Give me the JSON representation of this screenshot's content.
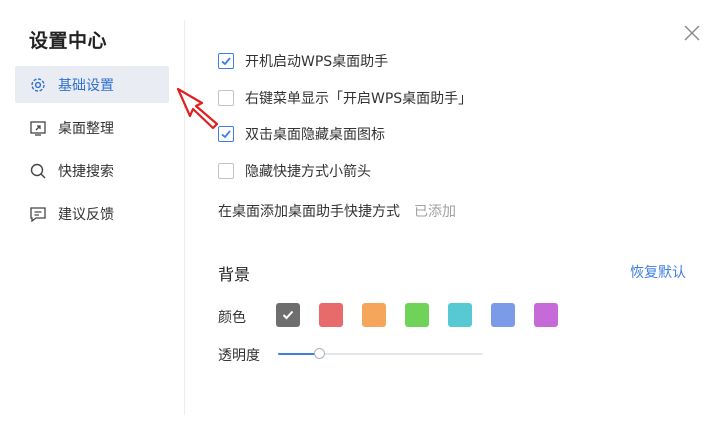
{
  "dialog": {
    "title": "设置中心"
  },
  "sidebar": {
    "items": [
      {
        "label": "基础设置",
        "icon": "gear-icon",
        "active": true
      },
      {
        "label": "桌面整理",
        "icon": "desktop-arrange-icon",
        "active": false
      },
      {
        "label": "快捷搜索",
        "icon": "search-icon",
        "active": false
      },
      {
        "label": "建议反馈",
        "icon": "feedback-icon",
        "active": false
      }
    ]
  },
  "options": [
    {
      "label": "开机启动WPS桌面助手",
      "checked": true
    },
    {
      "label": "右键菜单显示「开启WPS桌面助手」",
      "checked": false
    },
    {
      "label": "双击桌面隐藏桌面图标",
      "checked": true
    },
    {
      "label": "隐藏快捷方式小箭头",
      "checked": false
    }
  ],
  "shortcut": {
    "label": "在桌面添加桌面助手快捷方式",
    "status": "已添加"
  },
  "background": {
    "title": "背景",
    "reset_label": "恢复默认",
    "color_label": "颜色",
    "colors": [
      "#6e6e6e",
      "#e86b6b",
      "#f5a65b",
      "#6fd35a",
      "#57c9d3",
      "#7b9be8",
      "#c56ad8"
    ],
    "selected_color_index": 0,
    "opacity_label": "透明度",
    "opacity_value": 0.2
  },
  "accent_color": "#3f7fe4",
  "annotation_arrow_color": "#e02020"
}
